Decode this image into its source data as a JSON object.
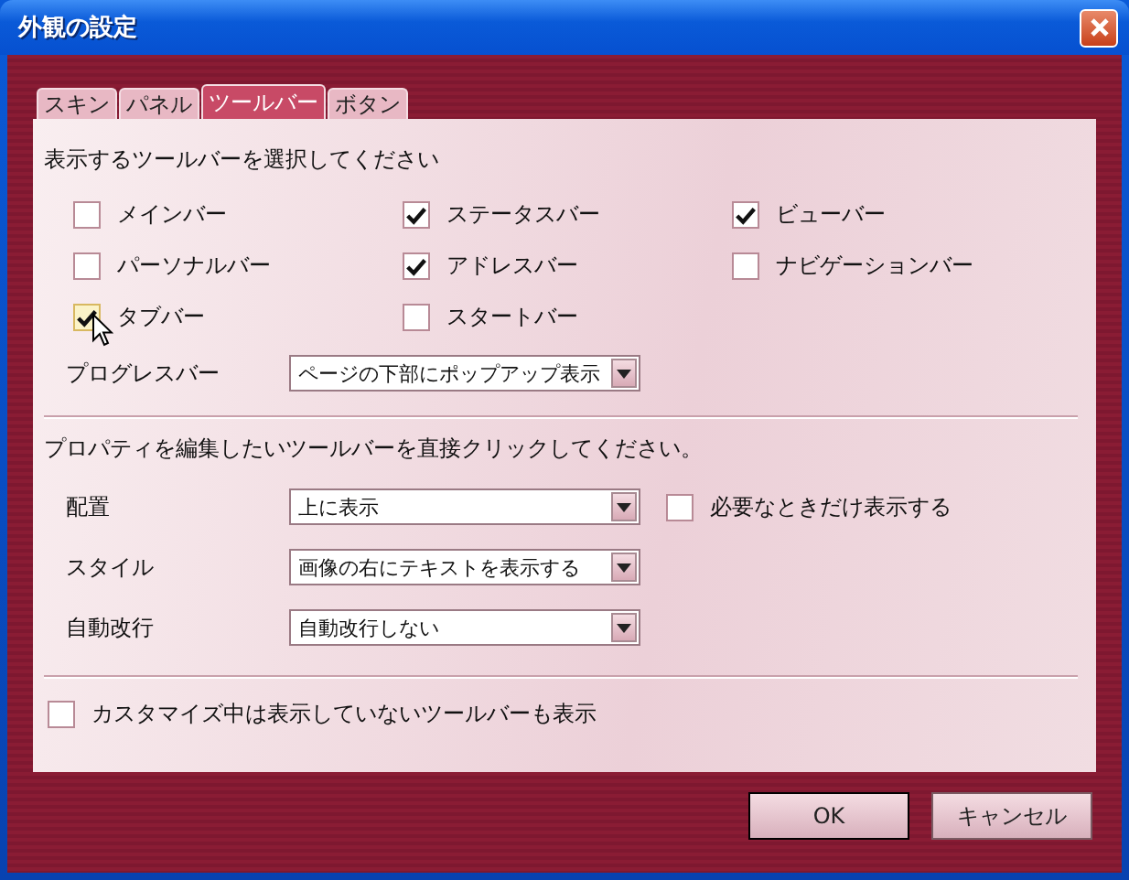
{
  "window": {
    "title": "外観の設定"
  },
  "tabs": [
    {
      "label": "スキン",
      "selected": false
    },
    {
      "label": "パネル",
      "selected": false
    },
    {
      "label": "ツールバー",
      "selected": true
    },
    {
      "label": "ボタン",
      "selected": false
    }
  ],
  "toolbars": {
    "heading": "表示するツールバーを選択してください",
    "items": [
      {
        "label": "メインバー",
        "checked": false
      },
      {
        "label": "ステータスバー",
        "checked": true
      },
      {
        "label": "ビューバー",
        "checked": true
      },
      {
        "label": "パーソナルバー",
        "checked": false
      },
      {
        "label": "アドレスバー",
        "checked": true
      },
      {
        "label": "ナビゲーションバー",
        "checked": false
      },
      {
        "label": "タブバー",
        "checked": true
      },
      {
        "label": "スタートバー",
        "checked": false
      }
    ],
    "progress_bar": {
      "label": "プログレスバー",
      "value": "ページの下部にポップアップ表示"
    }
  },
  "properties": {
    "heading": "プロパティを編集したいツールバーを直接クリックしてください。",
    "settings": [
      {
        "label": "配置",
        "value": "上に表示"
      },
      {
        "label": "スタイル",
        "value": "画像の右にテキストを表示する"
      },
      {
        "label": "自動改行",
        "value": "自動改行しない"
      }
    ],
    "auto_hide": {
      "label": "必要なときだけ表示する",
      "checked": false
    }
  },
  "show_hidden": {
    "label": "カスタマイズ中は表示していないツールバーも表示",
    "checked": false
  },
  "buttons": [
    "OK",
    "キャンセル"
  ]
}
